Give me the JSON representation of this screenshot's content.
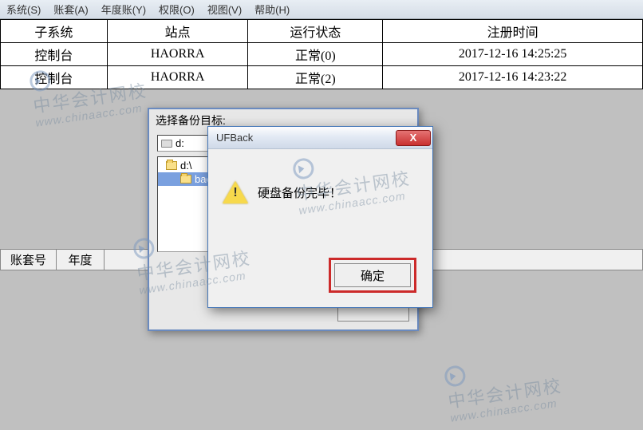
{
  "menubar": {
    "items": [
      "系统(S)",
      "账套(A)",
      "年度账(Y)",
      "权限(O)",
      "视图(V)",
      "帮助(H)"
    ]
  },
  "table": {
    "headers": [
      "子系统",
      "站点",
      "运行状态",
      "注册时间"
    ],
    "rows": [
      [
        "控制台",
        "HAORRA",
        "正常(0)",
        "2017-12-16 14:25:25"
      ],
      [
        "控制台",
        "HAORRA",
        "正常(2)",
        "2017-12-16 14:23:22"
      ]
    ]
  },
  "bottomTable": {
    "headers": [
      "账套号",
      "年度"
    ]
  },
  "selectDialog": {
    "title": "选择备份目标:",
    "drive": "d:",
    "treeRoot": "d:\\",
    "treeSelected": "backup"
  },
  "msgDialog": {
    "title": "UFBack",
    "message": "硬盘备份完毕！",
    "ok": "确定",
    "close": "X"
  },
  "watermark": {
    "cn": "中华会计网校",
    "en": "www.chinaacc.com"
  }
}
